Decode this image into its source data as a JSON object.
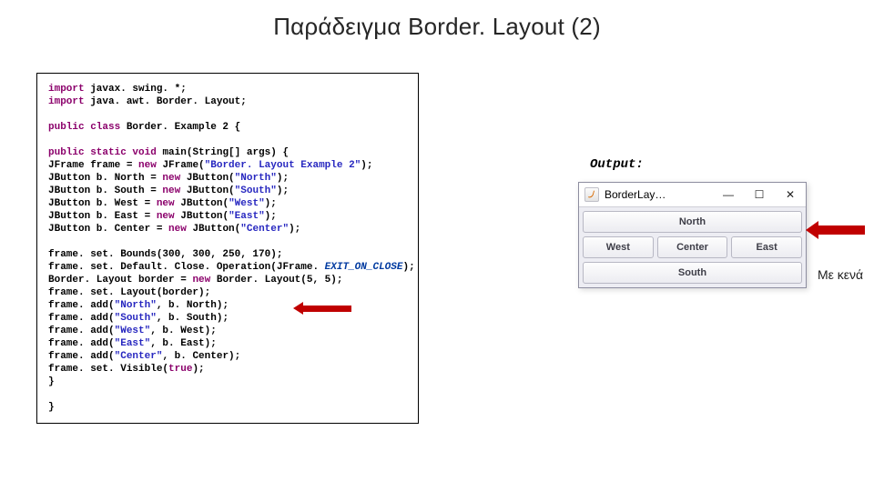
{
  "title": "Παράδειγμα Border. Layout (2)",
  "output_label": "Output:",
  "side_note": "Με κενά",
  "code": {
    "l1a": "import",
    "l1b": " javax. swing. *;",
    "l2a": "import",
    "l2b": " java. awt. Border. Layout;",
    "l3a": "public",
    "l3b": " class",
    "l3c": " Border. Example 2 {",
    "l4a": "public",
    "l4b": " static",
    "l4c": " void",
    "l4d": " main(String[] args) {",
    "l5a": "JFrame frame = ",
    "l5b": "new",
    "l5c": " JFrame(",
    "l5d": "\"Border. Layout Example 2\"",
    "l5e": ");",
    "l6a": "JButton b. North = ",
    "l6b": "new",
    "l6c": " JButton(",
    "l6d": "\"North\"",
    "l6e": ");",
    "l7a": "JButton b. South = ",
    "l7b": "new",
    "l7c": " JButton(",
    "l7d": "\"South\"",
    "l7e": ");",
    "l8a": "JButton b. West = ",
    "l8b": "new",
    "l8c": " JButton(",
    "l8d": "\"West\"",
    "l8e": ");",
    "l9a": "JButton b. East = ",
    "l9b": "new",
    "l9c": " JButton(",
    "l9d": "\"East\"",
    "l9e": ");",
    "l10a": "JButton b. Center = ",
    "l10b": "new",
    "l10c": " JButton(",
    "l10d": "\"Center\"",
    "l10e": ");",
    "l11": "frame. set. Bounds(300, 300, 250, 170);",
    "l12a": "frame. set. Default. Close. Operation(JFrame. ",
    "l12b": "EXIT_ON_CLOSE",
    "l12c": ");",
    "l13a": "Border. Layout border = ",
    "l13b": "new",
    "l13c": " Border. Layout(5, 5);",
    "l14": "frame. set. Layout(border);",
    "l15a": "frame. add(",
    "l15b": "\"North\"",
    "l15c": ", b. North);",
    "l16a": "frame. add(",
    "l16b": "\"South\"",
    "l16c": ", b. South);",
    "l17a": "frame. add(",
    "l17b": "\"West\"",
    "l17c": ", b. West);",
    "l18a": "frame. add(",
    "l18b": "\"East\"",
    "l18c": ", b. East);",
    "l19a": "frame. add(",
    "l19b": "\"Center\"",
    "l19c": ", b. Center);",
    "l20a": "frame. set. Visible(",
    "l20b": "true",
    "l20c": ");",
    "l21": "}",
    "l22": "}"
  },
  "window": {
    "title": "BorderLay…",
    "min": "—",
    "max": "☐",
    "close": "✕",
    "north": "North",
    "west": "West",
    "center": "Center",
    "east": "East",
    "south": "South"
  }
}
